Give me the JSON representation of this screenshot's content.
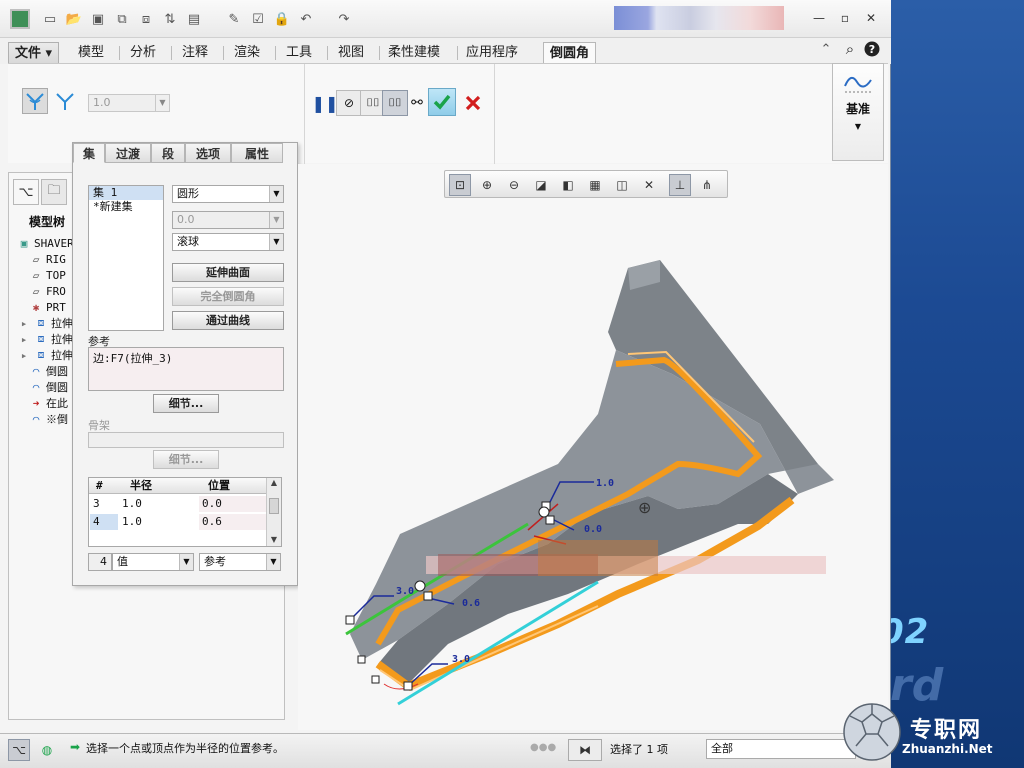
{
  "desktop": {
    "bg_text": "02"
  },
  "ribbon_tabs": [
    "文件",
    "模型",
    "分析",
    "注释",
    "渲染",
    "工具",
    "视图",
    "柔性建模",
    "应用程序",
    "倒圆角"
  ],
  "ribbon": {
    "value_combo": "1.0",
    "datum_label": "基准"
  },
  "left_panel": {
    "tree_title": "模型树",
    "tree_items": [
      "SHAVER_",
      "RIG",
      "TOP",
      "FRO",
      "PRT",
      "拉伸",
      "拉伸",
      "拉伸",
      "倒圆",
      "倒圆",
      "在此",
      "※倒"
    ]
  },
  "flyout": {
    "tabs": [
      "集",
      "过渡",
      "段",
      "选项",
      "属性"
    ],
    "sets": [
      "集 1",
      "*新建集"
    ],
    "shape_combo": "圆形",
    "value_combo": "0.0",
    "method_combo": "滚球",
    "btn_extend": "延伸曲面",
    "btn_full_round": "完全倒圆角",
    "btn_through_curve": "通过曲线",
    "references_label": "参考",
    "reference_value": "边:F7(拉伸_3)",
    "details_btn": "细节...",
    "skeleton_label": "骨架",
    "details_btn2": "细节...",
    "radius_table": {
      "headers": [
        "#",
        "半径",
        "位置"
      ],
      "rows": [
        {
          "idx": "3",
          "radius": "1.0",
          "pos": "0.0"
        },
        {
          "idx": "4",
          "radius": "1.0",
          "pos": "0.6"
        }
      ]
    },
    "bottom_index": "4",
    "bottom_value_combo": "值",
    "bottom_ref_combo": "参考"
  },
  "viewport": {
    "dims": [
      "1.0",
      "0.0",
      "3.0",
      "0.6",
      "3.0"
    ]
  },
  "status": {
    "message": "选择一个点或顶点作为半径的位置参考。",
    "selected": "选择了 1 项",
    "filter": "全部"
  },
  "watermark": {
    "site_name": "专职网",
    "site_url": "Zhuanzhi.Net"
  },
  "colors": {
    "accent_green": "#1aa34a",
    "cancel_red": "#d21d1d",
    "fillet_orange": "#f39a1c",
    "part_gray": "#8a9096"
  }
}
